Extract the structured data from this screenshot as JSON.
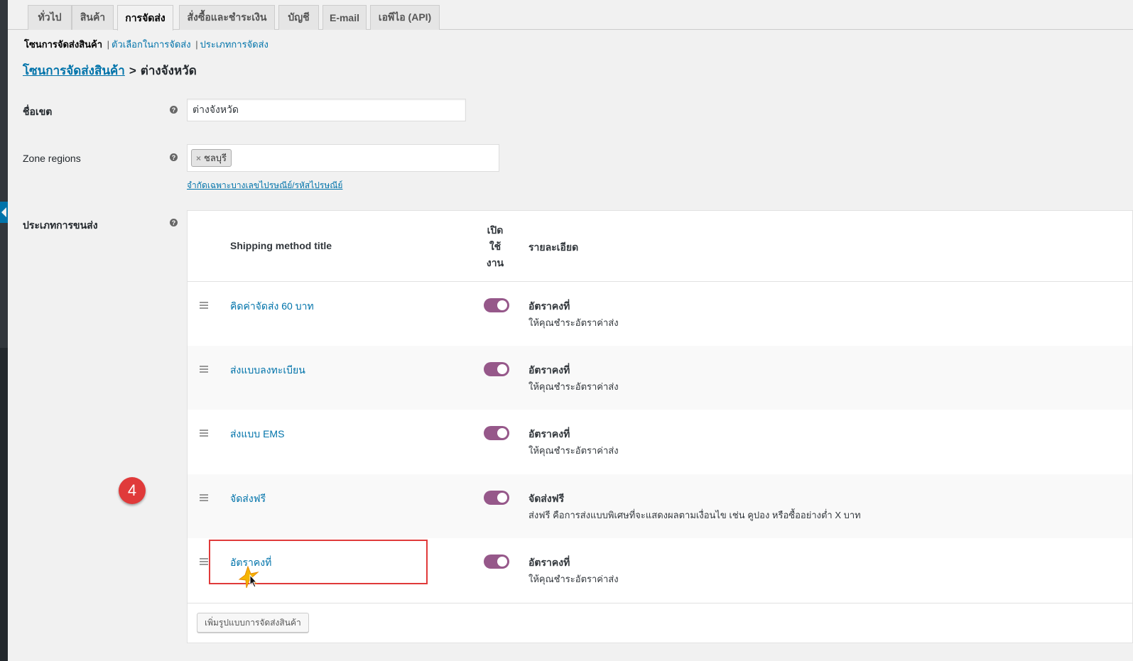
{
  "tabs": [
    {
      "label": "ทั่วไป",
      "active": false
    },
    {
      "label": "สินค้า",
      "active": false
    },
    {
      "label": "การจัดส่ง",
      "active": true
    },
    {
      "label": "สั่งซื้อและชำระเงิน",
      "active": false
    },
    {
      "label": "บัญชี",
      "active": false
    },
    {
      "label": "E-mail",
      "active": false
    },
    {
      "label": "เอพีไอ (API)",
      "active": false
    }
  ],
  "subsub": {
    "current": "โซนการจัดส่งสินค้า",
    "links": [
      "ตัวเลือกในการจัดส่ง",
      "ประเภทการจัดส่ง"
    ],
    "separator": "|"
  },
  "breadcrumb": {
    "parent": "โซนการจัดส่งสินค้า",
    "separator": ">",
    "current": "ต่างจังหวัด"
  },
  "form": {
    "zone_name_label": "ชื่อเขต",
    "zone_name_value": "ต่างจังหวัด",
    "zone_regions_label": "Zone regions",
    "region_chip": "ชลบุรี",
    "region_chip_remove": "×",
    "limit_postcode_link": "จำกัดเฉพาะบางเลขไปรษณีย์/รหัสไปรษณีย์",
    "shipping_methods_label": "ประเภทการขนส่ง",
    "help_glyph": "?"
  },
  "table": {
    "headers": {
      "title": "Shipping method title",
      "enabled_lines": [
        "เปิด",
        "ใช้",
        "งาน"
      ],
      "description": "รายละเอียด"
    },
    "rows": [
      {
        "title": "คิดค่าจัดส่ง 60 บาท",
        "enabled": true,
        "type": "อัตราคงที่",
        "desc": "ให้คุณชำระอัตราค่าส่ง"
      },
      {
        "title": "ส่งแบบลงทะเบียน",
        "enabled": true,
        "type": "อัตราคงที่",
        "desc": "ให้คุณชำระอัตราค่าส่ง"
      },
      {
        "title": "ส่งแบบ EMS",
        "enabled": true,
        "type": "อัตราคงที่",
        "desc": "ให้คุณชำระอัตราค่าส่ง"
      },
      {
        "title": "จัดส่งฟรี",
        "enabled": true,
        "type": "จัดส่งฟรี",
        "desc": "ส่งฟรี คือการส่งแบบพิเศษที่จะแสดงผลตามเงื่อนไข เช่น คูปอง หรือซื้ออย่างต่ำ X บาท"
      },
      {
        "title": "อัตราคงที่",
        "enabled": true,
        "type": "อัตราคงที่",
        "desc": "ให้คุณชำระอัตราค่าส่ง"
      }
    ],
    "add_button": "เพิ่มรูปแบบการจัดส่งสินค้า"
  },
  "annotation": {
    "step_number": "4",
    "color": "#e03a3a"
  },
  "colors": {
    "link": "#0073aa",
    "toggle_on": "#96588a",
    "background": "#f1f1f1"
  },
  "icons": {
    "help": "help-icon",
    "drag": "drag-handle-icon",
    "cursor": "mouse-cursor-icon"
  }
}
